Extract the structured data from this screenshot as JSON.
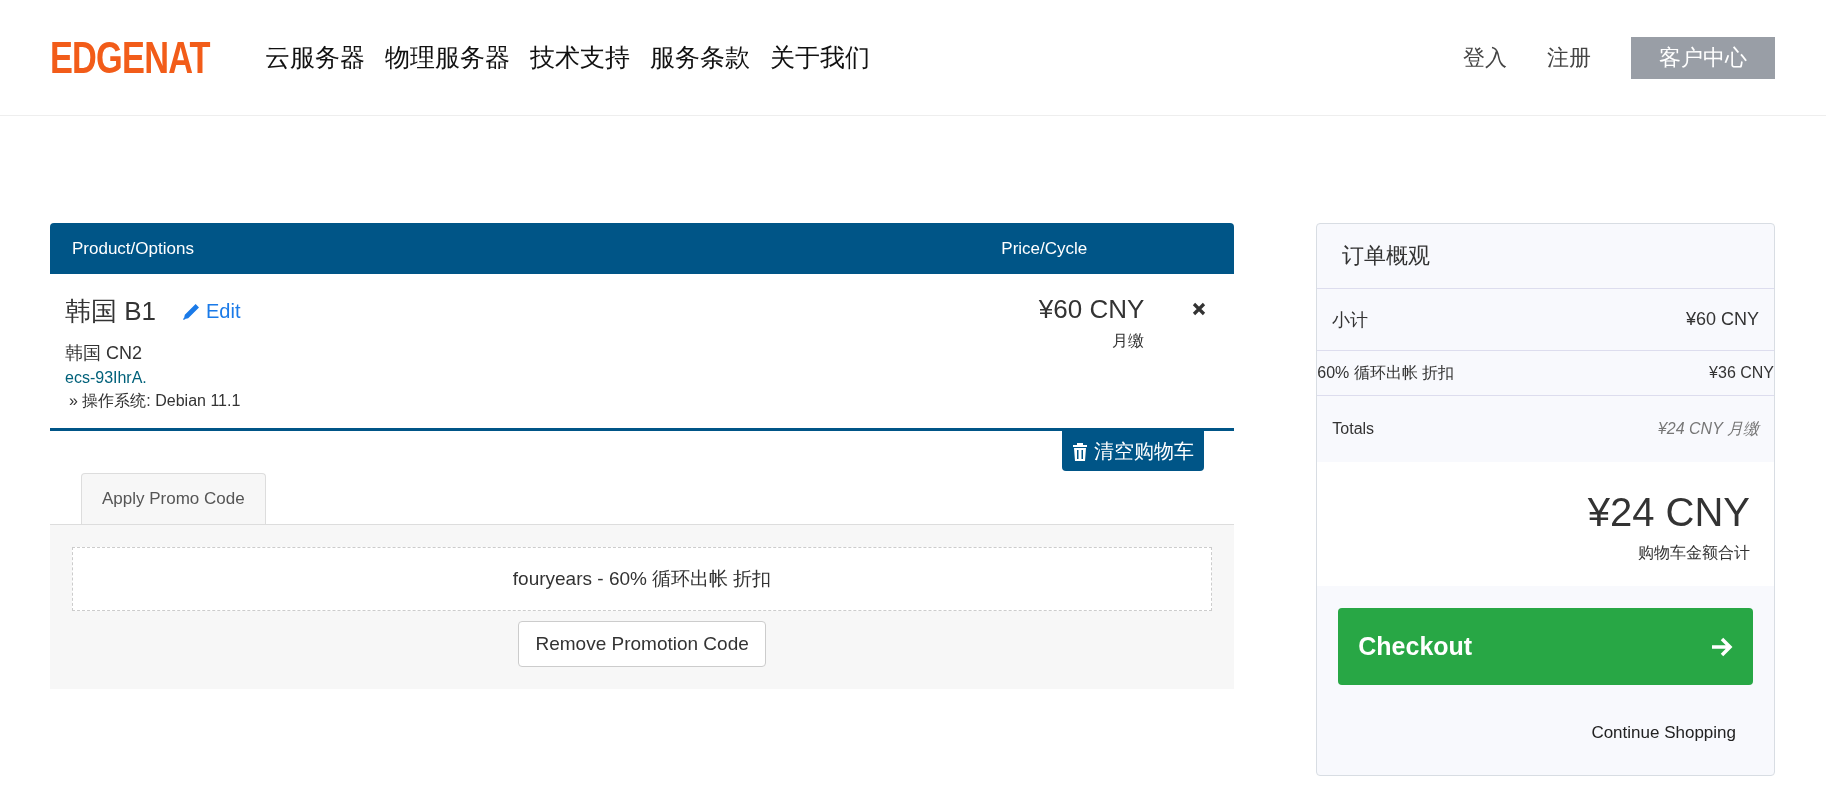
{
  "header": {
    "logo": "EDGENAT",
    "nav": [
      "云服务器",
      "物理服务器",
      "技术支持",
      "服务条款",
      "关于我们"
    ],
    "login": "登入",
    "register": "注册",
    "client_area": "客户中心"
  },
  "cart": {
    "columns": [
      "Product/Options",
      "Price/Cycle"
    ],
    "items": [
      {
        "name": "韩国 B1",
        "edit": "Edit",
        "group": "韩国 CN2",
        "hostname": "ecs-93IhrA.",
        "options": [
          "» 操作系统: Debian 11.1"
        ],
        "price": "¥60 CNY",
        "cycle": "月缴"
      }
    ],
    "clear_cart": "清空购物车"
  },
  "promo": {
    "tabs": [
      {
        "label": "Apply Promo Code",
        "selected": true
      }
    ],
    "applied": "fouryears - 60% 循环出帐 折扣",
    "remove_button": "Remove Promotion Code"
  },
  "summary": {
    "title": "订单概观",
    "rows": [
      {
        "kind": "subtotal",
        "label": "小计",
        "value": "¥60 CNY"
      },
      {
        "kind": "discount",
        "label": "60% 循环出帐 折扣",
        "value": "¥36 CNY"
      }
    ],
    "totals_label": "Totals",
    "totals_value": "¥24 CNY 月缴",
    "total_amount": "¥24 CNY",
    "total_caption": "购物车金额合计",
    "checkout": "Checkout",
    "continue": "Continue Shopping"
  }
}
